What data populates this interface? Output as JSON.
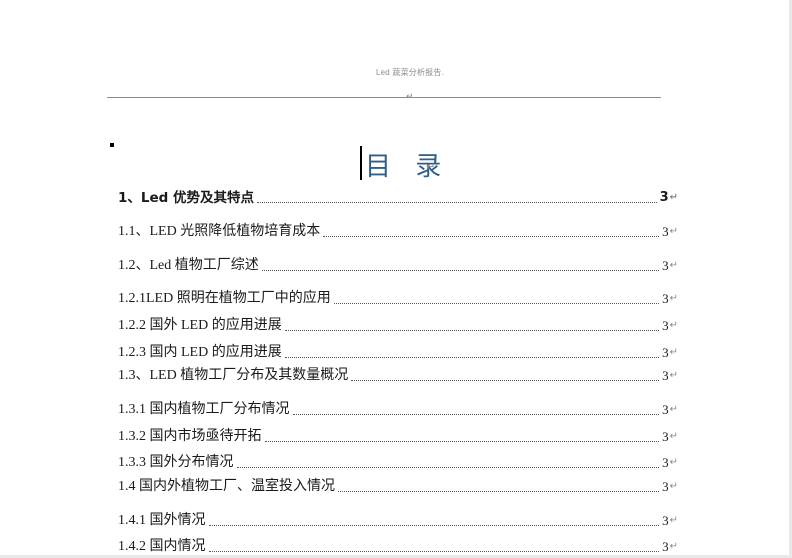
{
  "header": {
    "text": "Led 蔬菜分析报告.",
    "paragraph_mark": "↵"
  },
  "toc": {
    "title": "目 录",
    "title_mark": "↵",
    "entries": [
      {
        "label": "1、Led 优势及其特点",
        "page": "3",
        "mark": "↵"
      },
      {
        "label": "1.1、LED 光照降低植物培育成本",
        "page": "3",
        "mark": "↵"
      },
      {
        "label": "1.2、Led 植物工厂综述",
        "page": "3",
        "mark": "↵"
      },
      {
        "label": "1.2.1LED 照明在植物工厂中的应用",
        "page": "3",
        "mark": "↵"
      },
      {
        "label": "1.2.2 国外 LED 的应用进展",
        "page": "3",
        "mark": "↵"
      },
      {
        "label": "1.2.3 国内 LED 的应用进展",
        "page": "3",
        "mark": "↵"
      },
      {
        "label": "1.3、LED 植物工厂分布及其数量概况",
        "page": "3",
        "mark": "↵"
      },
      {
        "label": "1.3.1 国内植物工厂分布情况",
        "page": "3",
        "mark": "↵"
      },
      {
        "label": "1.3.2 国内市场亟待开拓",
        "page": "3",
        "mark": "↵"
      },
      {
        "label": "1.3.3 国外分布情况",
        "page": "3",
        "mark": "↵"
      },
      {
        "label": "1.4 国内外植物工厂、温室投入情况",
        "page": "3",
        "mark": "↵"
      },
      {
        "label": "1.4.1 国外情况",
        "page": "3",
        "mark": "↵"
      },
      {
        "label": "1.4.2 国内情况",
        "page": "3",
        "mark": "↵"
      }
    ]
  }
}
